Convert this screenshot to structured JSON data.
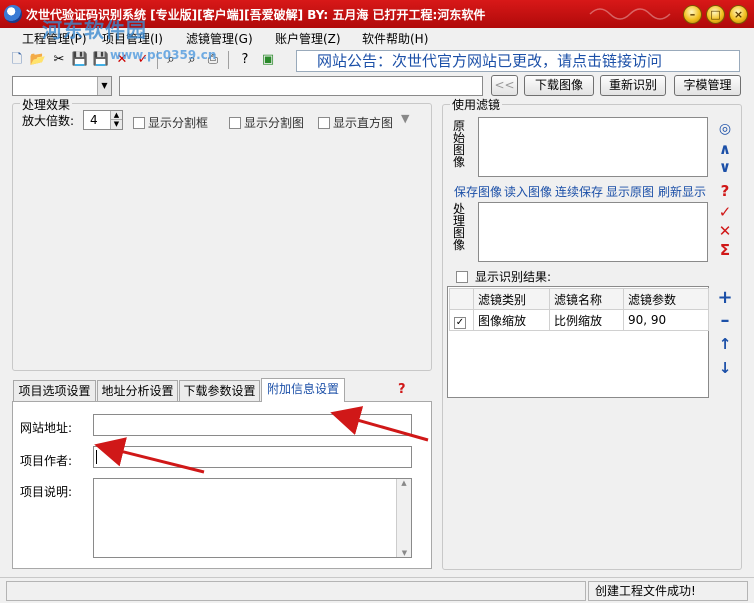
{
  "window": {
    "title": "次世代验证码识别系统 [专业版][客户端][吾爱破解] BY: 五月海 已打开工程:河东软件",
    "watermark": "河东软件园",
    "watermark_url": "www.pc0359.cn"
  },
  "menu": [
    "工程管理(P)",
    "项目管理(I)",
    "滤镜管理(G)",
    "账户管理(Z)",
    "软件帮助(H)"
  ],
  "notice": "网站公告：次世代官方网站已更改，请点击链接访问",
  "toolbar": {
    "prev_label": "<<",
    "download_label": "下载图像",
    "reidentify_label": "重新识别",
    "template_label": "字模管理"
  },
  "effects": {
    "group_label": "处理效果",
    "zoom_label": "放大倍数:",
    "zoom_value": "4",
    "show_split_box": "显示分割框",
    "show_split_image": "显示分割图",
    "show_histogram": "显示直方图"
  },
  "tabs": [
    "项目选项设置",
    "地址分析设置",
    "下载参数设置",
    "附加信息设置"
  ],
  "active_tab": "附加信息设置",
  "form": {
    "site_label": "网站地址:",
    "site_value": "",
    "author_label": "项目作者:",
    "author_value": "",
    "desc_label": "项目说明:",
    "desc_value": ""
  },
  "filters": {
    "group_label": "使用滤镜",
    "original_label": "原始图像",
    "processed_label": "处理图像",
    "links": [
      "保存图像",
      "读入图像",
      "连续保存",
      "显示原图",
      "刷新显示"
    ],
    "show_result_label": "显示识别结果:",
    "columns": [
      "滤镜类别",
      "滤镜名称",
      "滤镜参数"
    ],
    "rows": [
      {
        "checked": true,
        "category": "图像缩放",
        "name": "比例缩放",
        "params": "90, 90"
      }
    ]
  },
  "status": {
    "message": "创建工程文件成功!"
  },
  "colors": {
    "titlebar": "#c81010",
    "link": "#1c50a8",
    "arrow": "#d01818"
  }
}
